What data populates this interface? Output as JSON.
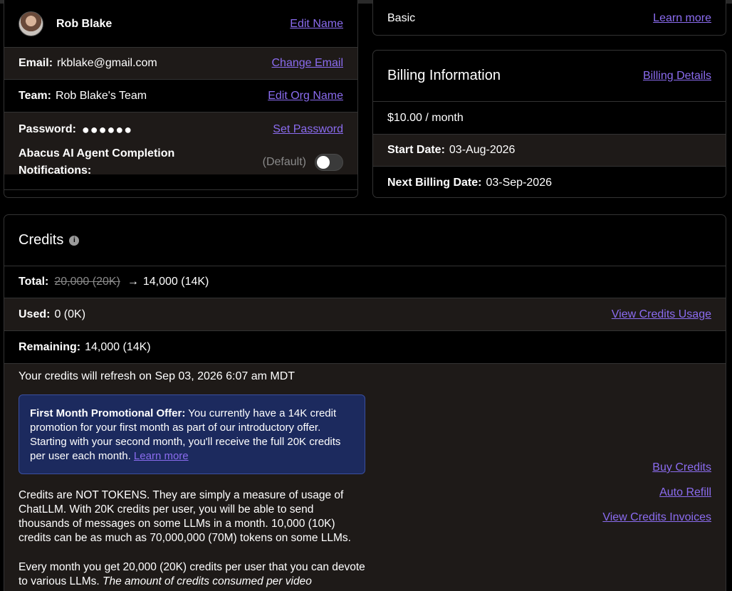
{
  "profile": {
    "name": "Rob Blake",
    "edit_name": "Edit Name",
    "email_label": "Email:",
    "email": "rkblake@gmail.com",
    "change_email": "Change Email",
    "team_label": "Team:",
    "team": "Rob Blake's Team",
    "edit_org": "Edit Org Name",
    "password_label": "Password:",
    "password_mask": "●●●●●●",
    "set_password": "Set Password",
    "notif_label_line1": "Abacus AI Agent Completion",
    "notif_label_line2": "Notifications:",
    "notif_default": "(Default)"
  },
  "plan": {
    "name": "Basic",
    "learn_more": "Learn more"
  },
  "billing": {
    "title": "Billing Information",
    "details_link": "Billing Details",
    "price": "$10.00 / month",
    "start_label": "Start Date:",
    "start_value": "03-Aug-2026",
    "next_label": "Next Billing Date:",
    "next_value": "03-Sep-2026"
  },
  "credits": {
    "title": "Credits",
    "info_icon": "i",
    "total_label": "Total:",
    "total_old": "20,000 (20K)",
    "arrow": "→",
    "total_new": "14,000 (14K)",
    "used_label": "Used:",
    "used_value": "0 (0K)",
    "view_usage": "View Credits Usage",
    "remaining_label": "Remaining:",
    "remaining_value": "14,000 (14K)",
    "refresh_text": "Your credits will refresh on Sep 03, 2026 6:07 am MDT",
    "promo_bold": "First Month Promotional Offer:",
    "promo_text": " You currently have a 14K credit promotion for your first month as part of our introductory offer. Starting with your second month, you'll receive the full 20K credits per user each month. ",
    "promo_link": "Learn more",
    "para1": "Credits are NOT TOKENS. They are simply a measure of usage of ChatLLM. With 20K credits per user, you will be able to send thousands of messages on some LLMs in a month. 10,000 (10K) credits can be as much as 70,000,000 (70M) tokens on some LLMs.",
    "para2_plain": "Every month you get 20,000 (20K) credits per user that you can devote to various LLMs. ",
    "para2_italic": "The amount of credits consumed per video",
    "buy_credits": "Buy Credits",
    "auto_refill": "Auto Refill",
    "view_invoices": "View Credits Invoices"
  }
}
